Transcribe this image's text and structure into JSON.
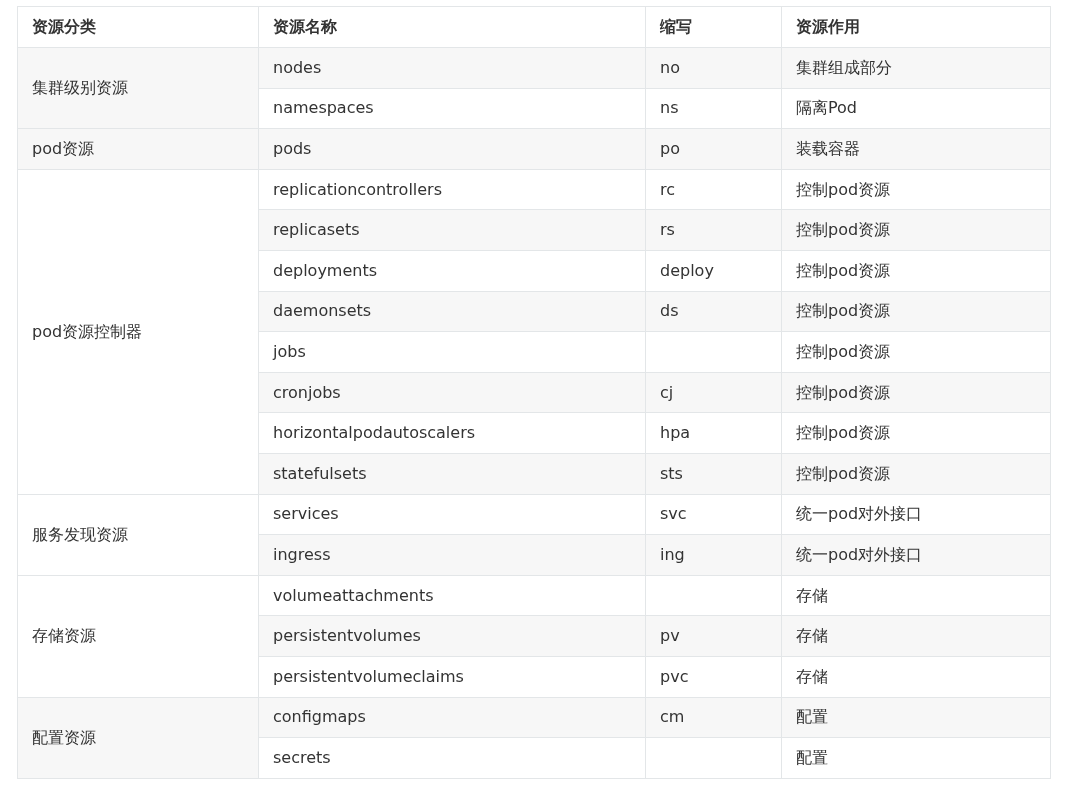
{
  "table": {
    "columns": [
      "资源分类",
      "资源名称",
      "缩写",
      "资源作用"
    ],
    "groups": [
      {
        "category": "集群级别资源",
        "rows": [
          {
            "name": "nodes",
            "short": "no",
            "purpose": "集群组成部分"
          },
          {
            "name": "namespaces",
            "short": "ns",
            "purpose": "隔离Pod"
          }
        ]
      },
      {
        "category": "pod资源",
        "rows": [
          {
            "name": "pods",
            "short": "po",
            "purpose": "装载容器"
          }
        ]
      },
      {
        "category": "pod资源控制器",
        "rows": [
          {
            "name": "replicationcontrollers",
            "short": "rc",
            "purpose": "控制pod资源"
          },
          {
            "name": "replicasets",
            "short": "rs",
            "purpose": "控制pod资源"
          },
          {
            "name": "deployments",
            "short": "deploy",
            "purpose": "控制pod资源"
          },
          {
            "name": "daemonsets",
            "short": "ds",
            "purpose": "控制pod资源"
          },
          {
            "name": "jobs",
            "purpose": "控制pod资源"
          },
          {
            "name": "cronjobs",
            "short": "cj",
            "purpose": "控制pod资源"
          },
          {
            "name": "horizontalpodautoscalers",
            "short": "hpa",
            "purpose": "控制pod资源"
          },
          {
            "name": "statefulsets",
            "short": "sts",
            "purpose": "控制pod资源"
          }
        ]
      },
      {
        "category": "服务发现资源",
        "rows": [
          {
            "name": "services",
            "short": "svc",
            "purpose": "统一pod对外接口"
          },
          {
            "name": "ingress",
            "short": "ing",
            "purpose": "统一pod对外接口"
          }
        ]
      },
      {
        "category": "存储资源",
        "rows": [
          {
            "name": "volumeattachments",
            "purpose": "存储"
          },
          {
            "name": "persistentvolumes",
            "short": "pv",
            "purpose": "存储"
          },
          {
            "name": "persistentvolumeclaims",
            "short": "pvc",
            "purpose": "存储"
          }
        ]
      },
      {
        "category": "配置资源",
        "rows": [
          {
            "name": "configmaps",
            "short": "cm",
            "purpose": "配置"
          },
          {
            "name": "secrets",
            "purpose": "配置"
          }
        ]
      }
    ]
  }
}
